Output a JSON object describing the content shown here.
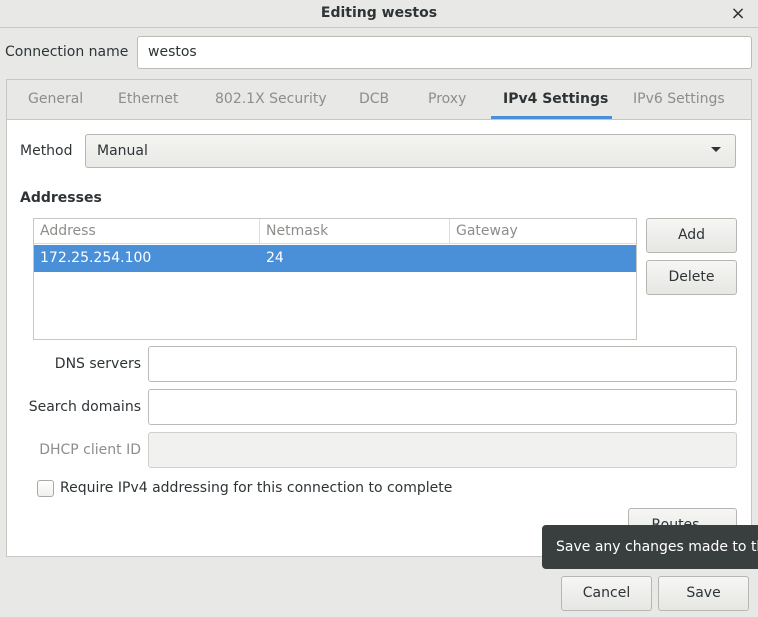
{
  "window": {
    "title": "Editing westos",
    "close_glyph": "×"
  },
  "connection": {
    "label": "Connection name",
    "value": "westos"
  },
  "tabs": [
    {
      "label": "General",
      "active": false
    },
    {
      "label": "Ethernet",
      "active": false
    },
    {
      "label": "802.1X Security",
      "active": false
    },
    {
      "label": "DCB",
      "active": false
    },
    {
      "label": "Proxy",
      "active": false
    },
    {
      "label": "IPv4 Settings",
      "active": true
    },
    {
      "label": "IPv6 Settings",
      "active": false
    }
  ],
  "method": {
    "label": "Method",
    "value": "Manual"
  },
  "addresses": {
    "heading": "Addresses",
    "columns": [
      "Address",
      "Netmask",
      "Gateway"
    ],
    "rows": [
      {
        "address": "172.25.254.100",
        "netmask": "24",
        "gateway": ""
      }
    ],
    "add_label": "Add",
    "delete_label": "Delete"
  },
  "dns": {
    "label": "DNS servers",
    "value": ""
  },
  "search_domains": {
    "label": "Search domains",
    "value": ""
  },
  "dhcp_client_id": {
    "label": "DHCP client ID",
    "value": ""
  },
  "require_ipv4": {
    "label": "Require IPv4 addressing for this connection to complete",
    "checked": false
  },
  "routes_label": "Routes…",
  "tooltip": "Save any changes made to th",
  "buttons": {
    "cancel": "Cancel",
    "save": "Save"
  },
  "colors": {
    "accent": "#4a90d9",
    "tooltip_bg": "#393f3f"
  }
}
